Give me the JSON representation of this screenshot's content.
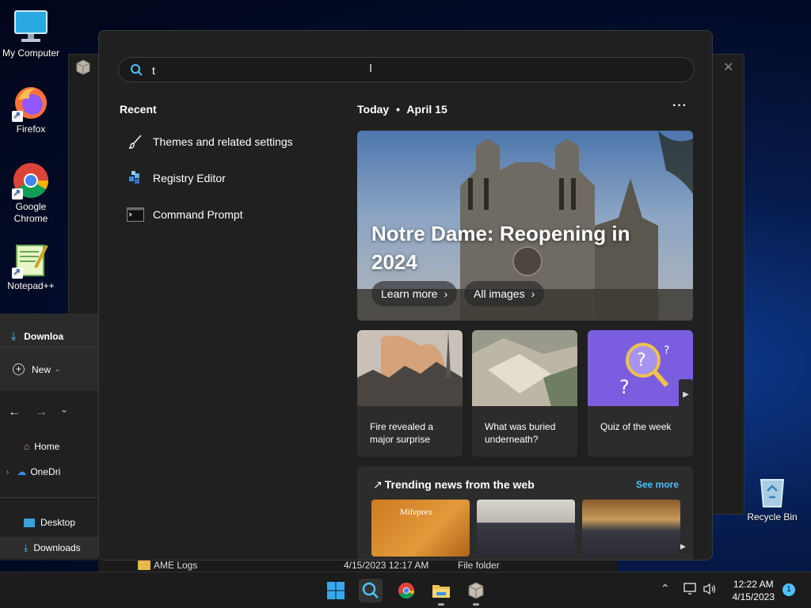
{
  "desktop": {
    "icons": [
      {
        "label": "My Computer"
      },
      {
        "label": "Firefox"
      },
      {
        "label": "Google Chrome"
      },
      {
        "label": "Notepad++"
      },
      {
        "label": "Recycle Bin"
      }
    ]
  },
  "explorer": {
    "toolbar_download": "Downloa",
    "new_label": "New",
    "nav_items": [
      "Home",
      "OneDri",
      "Desktop",
      "Downloads"
    ],
    "file_row": {
      "name": "AME Logs",
      "date": "4/15/2023 12:17 AM",
      "type": "File folder"
    }
  },
  "search": {
    "query": "t",
    "recent_title": "Recent",
    "recent_items": [
      {
        "label": "Themes and related settings",
        "icon": "brush-icon"
      },
      {
        "label": "Registry Editor",
        "icon": "registry-icon"
      },
      {
        "label": "Command Prompt",
        "icon": "cmd-icon"
      }
    ],
    "today_label": "Today",
    "date_label": "April 15",
    "more_glyph": "···",
    "hero": {
      "title": "Notre Dame: Reopening in 2024",
      "learn_more": "Learn more",
      "all_images": "All images"
    },
    "cards": [
      {
        "caption": "Fire revealed a major surprise"
      },
      {
        "caption": "What was buried underneath?"
      },
      {
        "caption": "Quiz of the week"
      }
    ],
    "trending": {
      "title": "Trending news from the web",
      "see_more": "See more",
      "thumb1_text": "Mifeprex"
    }
  },
  "taskbar": {
    "time": "12:22 AM",
    "date": "4/15/2023",
    "notification_count": "1"
  },
  "colors": {
    "accent": "#4cc2ff",
    "flyout_bg": "#202020",
    "card_bg": "#2c2c2c"
  }
}
